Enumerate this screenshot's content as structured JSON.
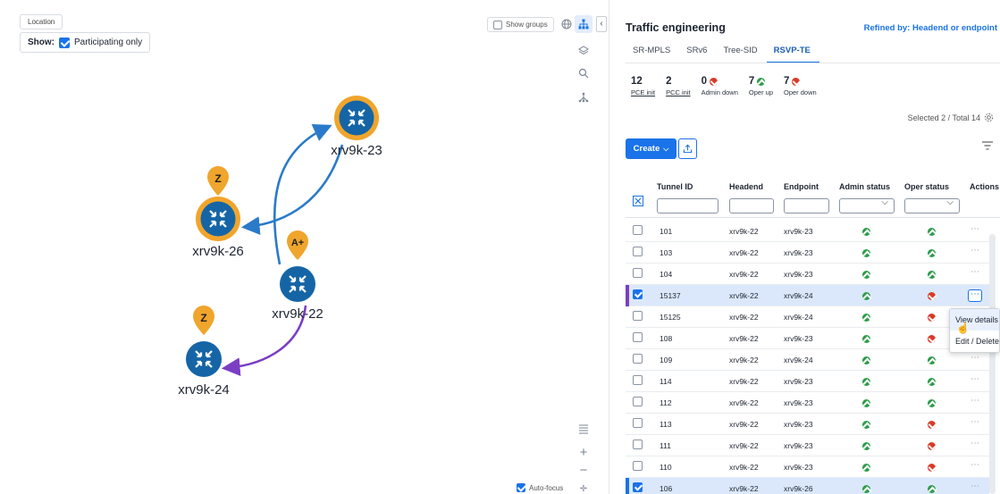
{
  "map": {
    "location_label": "Location",
    "show_label": "Show:",
    "participating_only": "Participating only",
    "show_groups": "Show groups",
    "auto_focus": "Auto-focus",
    "nodes": [
      {
        "name": "xrv9k-23",
        "badge": ""
      },
      {
        "name": "xrv9k-26",
        "badge": "Z"
      },
      {
        "name": "xrv9k-22",
        "badge": "A+"
      },
      {
        "name": "xrv9k-24",
        "badge": "Z"
      }
    ],
    "icons": [
      "globe-icon",
      "topology-icon",
      "layers-icon",
      "search-icon",
      "hierarchy-icon",
      "list-icon",
      "zoom-in-icon",
      "zoom-out-icon",
      "fit-icon"
    ]
  },
  "panel": {
    "title": "Traffic engineering",
    "refined_by": "Refined by: Headend or endpoint",
    "tabs": [
      {
        "label": "SR-MPLS",
        "active": false
      },
      {
        "label": "SRv6",
        "active": false
      },
      {
        "label": "Tree-SID",
        "active": false
      },
      {
        "label": "RSVP-TE",
        "active": true
      }
    ],
    "stats": [
      {
        "value": "12",
        "label": "PCE init",
        "status": ""
      },
      {
        "value": "2",
        "label": "PCC init",
        "status": ""
      },
      {
        "value": "0",
        "label": "Admin down",
        "status": "down"
      },
      {
        "value": "7",
        "label": "Oper up",
        "status": "up"
      },
      {
        "value": "7",
        "label": "Oper down",
        "status": "down"
      }
    ],
    "selected_total": "Selected 2 / Total 14",
    "create_label": "Create",
    "columns": [
      "Tunnel ID",
      "Headend",
      "Endpoint",
      "Admin status",
      "Oper status",
      "Actions"
    ],
    "rows": [
      {
        "id": "101",
        "headend": "xrv9k-22",
        "endpoint": "xrv9k-23",
        "admin": "up",
        "oper": "up",
        "selected": false
      },
      {
        "id": "103",
        "headend": "xrv9k-22",
        "endpoint": "xrv9k-23",
        "admin": "up",
        "oper": "up",
        "selected": false
      },
      {
        "id": "104",
        "headend": "xrv9k-22",
        "endpoint": "xrv9k-23",
        "admin": "up",
        "oper": "up",
        "selected": false
      },
      {
        "id": "15137",
        "headend": "xrv9k-22",
        "endpoint": "xrv9k-24",
        "admin": "up",
        "oper": "down",
        "selected": true,
        "bar": "#7b3fc4"
      },
      {
        "id": "15125",
        "headend": "xrv9k-22",
        "endpoint": "xrv9k-24",
        "admin": "up",
        "oper": "down",
        "selected": false
      },
      {
        "id": "108",
        "headend": "xrv9k-22",
        "endpoint": "xrv9k-23",
        "admin": "up",
        "oper": "down",
        "selected": false
      },
      {
        "id": "109",
        "headend": "xrv9k-22",
        "endpoint": "xrv9k-24",
        "admin": "up",
        "oper": "up",
        "selected": false
      },
      {
        "id": "114",
        "headend": "xrv9k-22",
        "endpoint": "xrv9k-23",
        "admin": "up",
        "oper": "up",
        "selected": false
      },
      {
        "id": "112",
        "headend": "xrv9k-22",
        "endpoint": "xrv9k-23",
        "admin": "up",
        "oper": "up",
        "selected": false
      },
      {
        "id": "113",
        "headend": "xrv9k-22",
        "endpoint": "xrv9k-23",
        "admin": "up",
        "oper": "down",
        "selected": false
      },
      {
        "id": "111",
        "headend": "xrv9k-22",
        "endpoint": "xrv9k-23",
        "admin": "up",
        "oper": "down",
        "selected": false
      },
      {
        "id": "110",
        "headend": "xrv9k-22",
        "endpoint": "xrv9k-23",
        "admin": "up",
        "oper": "down",
        "selected": false
      },
      {
        "id": "106",
        "headend": "xrv9k-22",
        "endpoint": "xrv9k-26",
        "admin": "up",
        "oper": "up",
        "selected": true,
        "bar": "#1a73e8"
      }
    ],
    "context_menu": [
      "View details",
      "Edit / Delete"
    ]
  },
  "colors": {
    "accent": "#1a73e8",
    "node": "#1565a6",
    "ring": "#f0a52c",
    "up": "#2d9c4a",
    "down": "#d93a26",
    "purple_path": "#7b3fc4",
    "blue_path": "#2a7ac9"
  }
}
